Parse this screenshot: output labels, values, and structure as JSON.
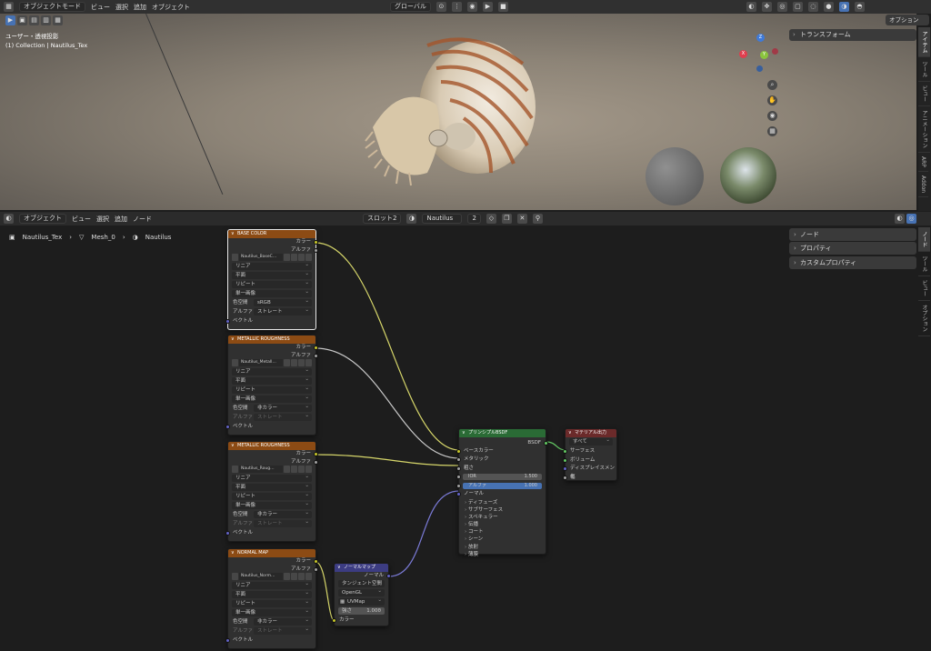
{
  "top_header": {
    "mode": "オブジェクトモード",
    "menus": [
      "ビュー",
      "選択",
      "追加",
      "オブジェクト"
    ],
    "orientation": "グローバル",
    "options": "オプション"
  },
  "viewport": {
    "view_name": "ユーザー・透視投影",
    "collection_line": "(1) Collection | Nautilus_Tex",
    "transform_panel": "トランスフォーム",
    "tabs": [
      "アイテム",
      "ツール",
      "ビュー",
      "アニメーション",
      "ARP",
      "Addon"
    ],
    "gizmo": {
      "x": "X",
      "y": "Y",
      "z": "Z"
    }
  },
  "node_header": {
    "editor_type": "オブジェクト",
    "menus": [
      "ビュー",
      "選択",
      "追加",
      "ノード"
    ],
    "slot": "スロット2",
    "material": "Nautilus",
    "users": "2"
  },
  "breadcrumb": [
    "Nautilus_Tex",
    "Mesh_0",
    "Nautilus"
  ],
  "node_sidebar": {
    "panels": [
      "ノード",
      "プロパティ",
      "カスタムプロパティ"
    ],
    "tabs": [
      "ノード",
      "ツール",
      "ビュー",
      "オプション"
    ]
  },
  "nodes": {
    "tex1": {
      "title": "BASE COLOR",
      "outputs": [
        "カラー",
        "アルファ"
      ],
      "image": "Nautilus_BaseC…",
      "interp": "リニア",
      "proj": "平面",
      "ext": "リピート",
      "source": "単一画像",
      "cs_label": "色空間",
      "cs": "sRGB",
      "alpha_label": "アルファ",
      "alpha": "ストレート",
      "vector": "ベクトル"
    },
    "tex2": {
      "title": "METALLIC ROUGHNESS",
      "outputs": [
        "カラー",
        "アルファ"
      ],
      "image": "Nautilus_Metall…",
      "interp": "リニア",
      "proj": "平面",
      "ext": "リピート",
      "source": "単一画像",
      "cs_label": "色空間",
      "cs": "非カラー",
      "alpha_label": "アルファ",
      "alpha": "ストレート",
      "vector": "ベクトル"
    },
    "tex3": {
      "title": "METALLIC ROUGHNESS",
      "outputs": [
        "カラー",
        "アルファ"
      ],
      "image": "Nautilus_Roug…",
      "interp": "リニア",
      "proj": "平面",
      "ext": "リピート",
      "source": "単一画像",
      "cs_label": "色空間",
      "cs": "非カラー",
      "alpha_label": "アルファ",
      "alpha": "ストレート",
      "vector": "ベクトル"
    },
    "tex4": {
      "title": "NORMAL MAP",
      "outputs": [
        "カラー",
        "アルファ"
      ],
      "image": "Nautilus_Norm…",
      "interp": "リニア",
      "proj": "平面",
      "ext": "リピート",
      "source": "単一画像",
      "cs_label": "色空間",
      "cs": "非カラー",
      "alpha_label": "アルファ",
      "alpha": "ストレート",
      "vector": "ベクトル"
    },
    "normalmap": {
      "title": "ノーマルマップ",
      "output": "ノーマル",
      "space": "タンジェント空間",
      "convention": "OpenGL",
      "uv": "UVMap",
      "strength_label": "強さ",
      "strength": "1.000",
      "color": "カラー"
    },
    "bsdf": {
      "title": "プリンシプルBSDF",
      "output": "BSDF",
      "base": "ベースカラー",
      "metallic": "メタリック",
      "rough": "粗さ",
      "ior_label": "IOR",
      "ior": "1.500",
      "alpha_label": "アルファ",
      "alpha": "1.000",
      "normal": "ノーマル",
      "sections": [
        "ディフューズ",
        "サブサーフェス",
        "スペキュラー",
        "伝播",
        "コート",
        "シーン",
        "放射",
        "薄膜"
      ]
    },
    "output": {
      "title": "マテリアル出力",
      "target": "すべて",
      "inputs": [
        "サーフェス",
        "ボリューム",
        "ディスプレイスメント",
        "幅"
      ]
    }
  }
}
